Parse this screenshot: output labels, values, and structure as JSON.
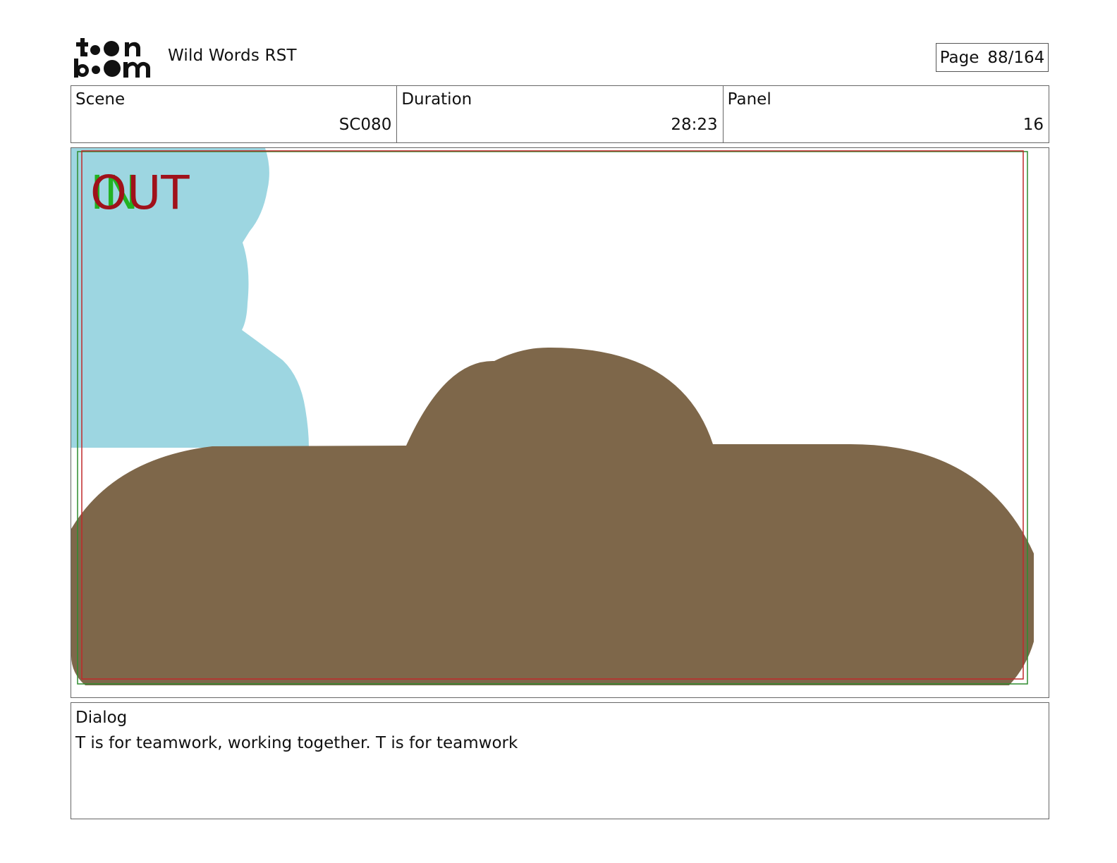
{
  "header": {
    "brand": "toon boom",
    "project_title": "Wild Words RST",
    "page_label": "Page",
    "page_value": "88/164"
  },
  "info": {
    "scene": {
      "label": "Scene",
      "value": "SC080"
    },
    "duration": {
      "label": "Duration",
      "value": "28:23"
    },
    "panel": {
      "label": "Panel",
      "value": "16"
    }
  },
  "panel_image": {
    "in_label": "IN",
    "out_label": "OUT",
    "colors": {
      "sky": "#9dd6e1",
      "ground": "#7e674a",
      "safe_frame_green": "#2e8b2e",
      "safe_frame_red": "#c0282a",
      "in_text": "#22b222",
      "out_text": "#a0111a"
    }
  },
  "dialog": {
    "label": "Dialog",
    "text": "T is for teamwork, working together. T is for teamwork"
  }
}
